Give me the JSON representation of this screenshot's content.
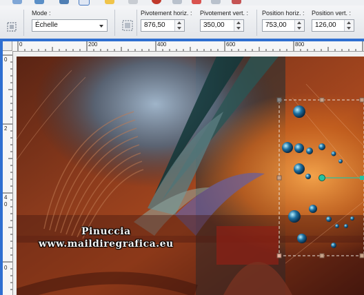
{
  "toolbar": {
    "mode_label": "Mode :",
    "mode_value": "Échelle",
    "pivot_h_label": "Pivotement horiz. :",
    "pivot_h_value": "876,50",
    "pivot_v_label": "Pivotement vert. :",
    "pivot_v_value": "350,00",
    "pos_h_label": "Position horiz. :",
    "pos_h_value": "753,00",
    "pos_v_label": "Position vert. :",
    "pos_v_value": "126,00"
  },
  "ruler": {
    "h_labels": [
      "0",
      "200",
      "400",
      "600",
      "800"
    ],
    "v_labels": [
      "0",
      "2",
      "4",
      "0",
      "0"
    ]
  },
  "image": {
    "watermark_name": "Pinuccia",
    "watermark_url": "www.maildiregrafica.eu"
  },
  "colors": {
    "accent": "#2f6fd1",
    "bubble": "#26c3a0",
    "handle": "#c7a38a"
  }
}
